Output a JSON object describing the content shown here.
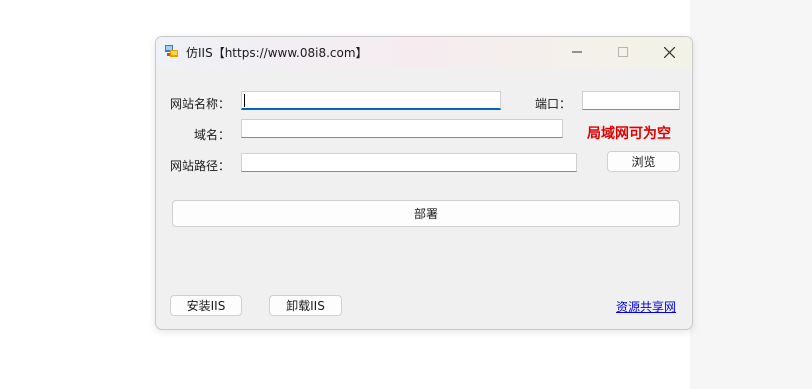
{
  "window": {
    "title": "仿IIS【https://www.08i8.com】"
  },
  "form": {
    "site_name_label": "网站名称：",
    "site_name_value": "",
    "port_label": "端口：",
    "port_value": "",
    "domain_label": "域名：",
    "domain_value": "",
    "lan_note": "局域网可为空",
    "path_label": "网站路径：",
    "path_value": "",
    "browse_button": "浏览",
    "deploy_button": "部署"
  },
  "footer": {
    "install_button": "安装IIS",
    "uninstall_button": "卸载IIS",
    "resource_link": "资源共享网"
  },
  "colors": {
    "note": "#e00000",
    "link": "#0000ee",
    "focus": "#0067c0"
  }
}
